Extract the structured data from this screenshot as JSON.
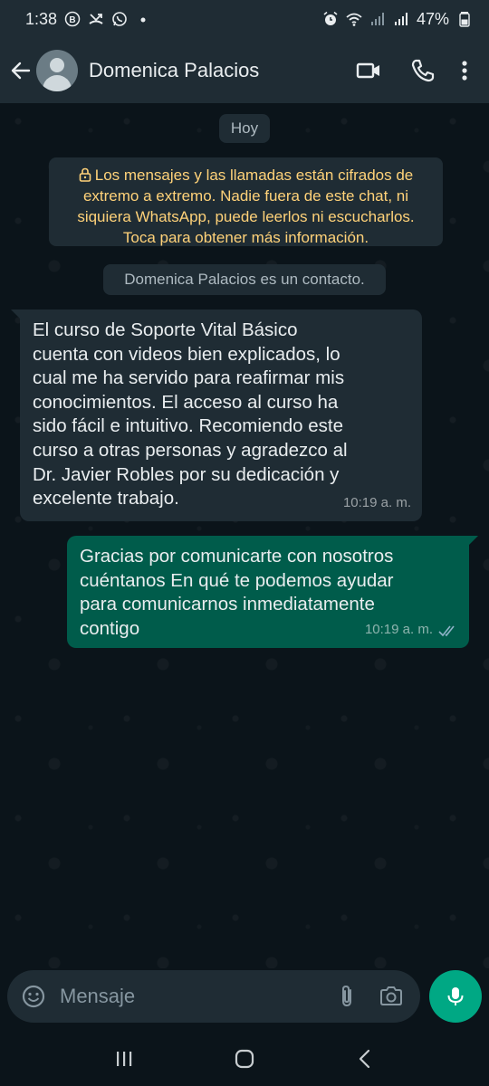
{
  "status_bar": {
    "time": "1:38",
    "battery": "47%",
    "icons": [
      "b-badge-icon",
      "missed-call-icon",
      "whatsapp-icon",
      "dot-icon",
      "alarm-icon",
      "wifi-icon",
      "signal-icon",
      "signal-icon",
      "battery-icon"
    ]
  },
  "header": {
    "contact_name": "Domenica Palacios",
    "icons": [
      "back-arrow-icon",
      "avatar-icon",
      "video-call-icon",
      "voice-call-icon",
      "more-vert-icon"
    ]
  },
  "chat": {
    "date_chip": "Hoy",
    "encryption_notice": "Los mensajes y las llamadas están cifrados de extremo a extremo. Nadie fuera de este chat, ni siquiera WhatsApp, puede leerlos ni escucharlos. Toca para obtener más información.",
    "contact_notice": "Domenica Palacios es un contacto.",
    "messages": [
      {
        "direction": "incoming",
        "text": "El curso de Soporte Vital Básico\ncuenta con videos bien explicados, lo\ncual me ha servido para reafirmar mis\nconocimientos. El acceso al curso ha\nsido fácil e intuitivo. Recomiendo este\ncurso a otras personas y agradezco al\nDr. Javier Robles por su dedicación y\nexcelente trabajo.",
        "time": "10:19 a. m."
      },
      {
        "direction": "outgoing",
        "text": "Gracias por comunicarte con nosotros\ncuéntanos En qué te podemos ayudar\npara comunicarnos inmediatamente\ncontigo",
        "time": "10:19 a. m.",
        "status": "read"
      }
    ]
  },
  "input": {
    "placeholder": "Mensaje"
  },
  "colors": {
    "background": "#0b141a",
    "header": "#1f2c34",
    "incoming_bubble": "#1f2c34",
    "outgoing_bubble": "#005c4b",
    "accent": "#00a884",
    "notice_text": "#ffd279",
    "read_ticks": "#8fb3c8"
  }
}
